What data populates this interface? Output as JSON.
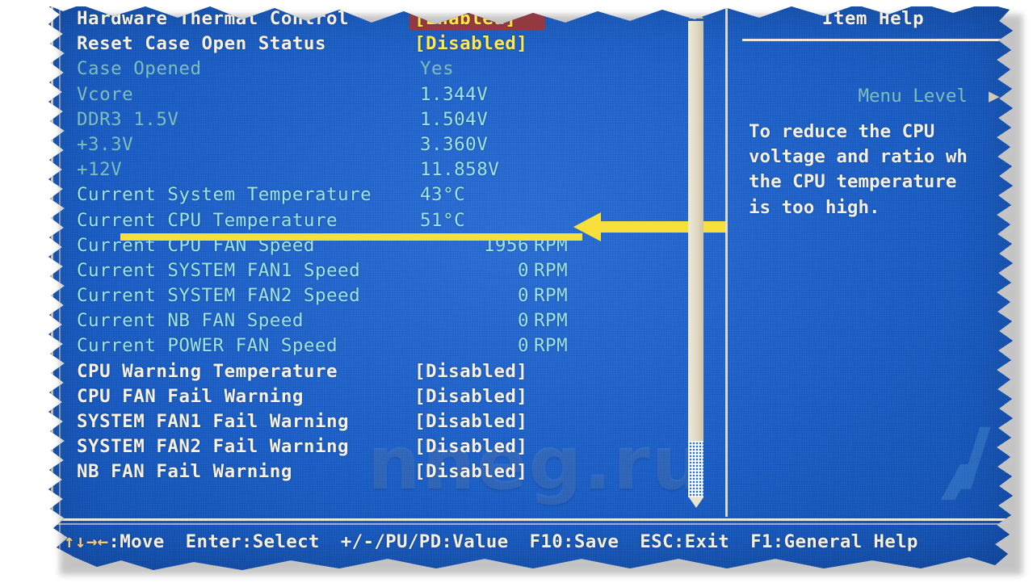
{
  "screen": {
    "background_color": "#1a5ec6",
    "accent_cream": "#f3efe4",
    "accent_cyan": "#9fe4e2",
    "accent_yellow": "#ffe84d",
    "selection_color": "#a8342c"
  },
  "main_list": {
    "rows": [
      {
        "label": "Hardware Thermal Control",
        "value": "[Enabled]",
        "label_style": "cream",
        "value_style": "yellow",
        "selected": true,
        "kind": "setting"
      },
      {
        "label": "Reset Case Open Status",
        "value": "[Disabled]",
        "label_style": "cream",
        "value_style": "yellow",
        "selected": false,
        "kind": "setting"
      },
      {
        "label": "Case Opened",
        "value": "Yes",
        "label_style": "dimcy",
        "value_style": "dimcy",
        "selected": false,
        "kind": "readout"
      },
      {
        "label": "Vcore",
        "value": "1.344V",
        "label_style": "dimcy",
        "value_style": "cyan",
        "selected": false,
        "kind": "readout"
      },
      {
        "label": "DDR3 1.5V",
        "value": "1.504V",
        "label_style": "dimcy",
        "value_style": "cyan",
        "selected": false,
        "kind": "readout"
      },
      {
        "label": "+3.3V",
        "value": "3.360V",
        "label_style": "dimcy",
        "value_style": "cyan",
        "selected": false,
        "kind": "readout"
      },
      {
        "label": "+12V",
        "value": "11.858V",
        "label_style": "dimcy",
        "value_style": "cyan",
        "selected": false,
        "kind": "readout"
      },
      {
        "label": "Current System Temperature",
        "value": "43°C",
        "label_style": "cyan",
        "value_style": "cyan",
        "selected": false,
        "kind": "readout"
      },
      {
        "label": "Current CPU Temperature",
        "value": "51°C",
        "label_style": "cyan",
        "value_style": "cyan",
        "selected": false,
        "kind": "readout",
        "annotated": true
      },
      {
        "label": "Current CPU FAN Speed",
        "value": "1956",
        "unit": "RPM",
        "label_style": "cyan",
        "value_style": "cyan",
        "selected": false,
        "kind": "rpm"
      },
      {
        "label": "Current SYSTEM FAN1 Speed",
        "value": "0",
        "unit": "RPM",
        "label_style": "cyan",
        "value_style": "cyan",
        "selected": false,
        "kind": "rpm"
      },
      {
        "label": "Current SYSTEM FAN2 Speed",
        "value": "0",
        "unit": "RPM",
        "label_style": "cyan",
        "value_style": "cyan",
        "selected": false,
        "kind": "rpm"
      },
      {
        "label": "Current NB FAN Speed",
        "value": "0",
        "unit": "RPM",
        "label_style": "cyan",
        "value_style": "cyan",
        "selected": false,
        "kind": "rpm"
      },
      {
        "label": "Current POWER FAN Speed",
        "value": "0",
        "unit": "RPM",
        "label_style": "cyan",
        "value_style": "cyan",
        "selected": false,
        "kind": "rpm"
      },
      {
        "label": "CPU Warning Temperature",
        "value": "[Disabled]",
        "label_style": "cream",
        "value_style": "cream",
        "selected": false,
        "kind": "setting"
      },
      {
        "label": "CPU FAN Fail Warning",
        "value": "[Disabled]",
        "label_style": "cream",
        "value_style": "cream",
        "selected": false,
        "kind": "setting"
      },
      {
        "label": "SYSTEM FAN1 Fail Warning",
        "value": "[Disabled]",
        "label_style": "cream",
        "value_style": "cream",
        "selected": false,
        "kind": "setting"
      },
      {
        "label": "SYSTEM FAN2 Fail Warning",
        "value": "[Disabled]",
        "label_style": "cream",
        "value_style": "cream",
        "selected": false,
        "kind": "setting"
      },
      {
        "label": "NB FAN Fail Warning",
        "value": "[Disabled]",
        "label_style": "cream",
        "value_style": "cream",
        "selected": false,
        "kind": "setting"
      }
    ]
  },
  "help_panel": {
    "title": "Item Help",
    "menu_level_label": "Menu Level",
    "menu_level_arrow": "▶",
    "body_lines": [
      "To reduce the CPU",
      "voltage and ratio wh",
      "the CPU temperature",
      "is too high."
    ]
  },
  "scrollbar": {
    "up_arrow": "▲",
    "down_arrow": "▼",
    "thumb_position_percent": 2,
    "thumb_size_percent": 84
  },
  "key_bar": {
    "items": [
      {
        "keys": "↑↓→←",
        "action": ":Move"
      },
      {
        "keys": "Enter",
        "action": ":Select"
      },
      {
        "keys": "+/-/PU/PD",
        "action": ":Value"
      },
      {
        "keys": "F10",
        "action": ":Save"
      },
      {
        "keys": "ESC",
        "action": ":Exit"
      },
      {
        "keys": "F1",
        "action": ":General Help"
      }
    ]
  },
  "annotation": {
    "underline_color": "#f7e03c",
    "arrow_color": "#f7e03c",
    "points_at": "Current CPU Temperature  51°C"
  },
  "watermark": {
    "text": "nneg.ru"
  }
}
